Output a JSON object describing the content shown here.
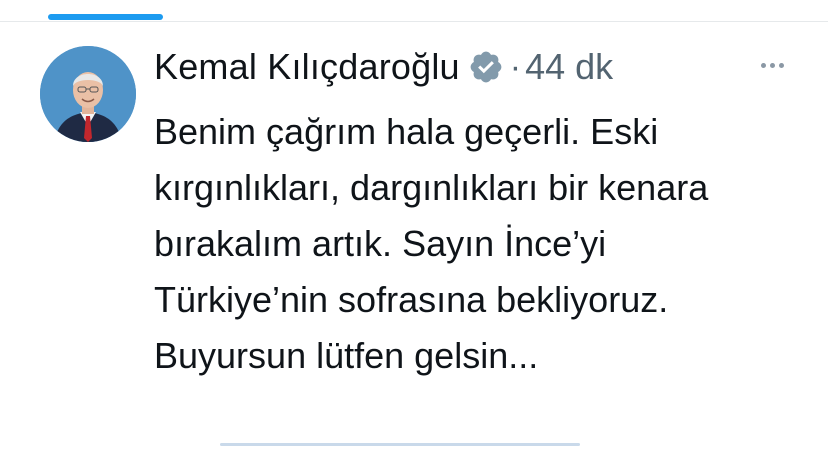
{
  "tweet": {
    "author_name": "Kemal Kılıçdaroğlu",
    "separator": "·",
    "time": "44 dk",
    "text": "Benim çağrım hala geçerli. Eski\nkırgınlıkları, dargınlıkları bir kenara\nbırakalım artık. Sayın İnce’yi\nTürkiye’nin sofrasına bekliyoruz.\nBuyursun lütfen gelsin..."
  },
  "icons": {
    "verified": "verified-badge-icon",
    "more": "more-options-icon"
  },
  "colors": {
    "accent": "#1d9bf0",
    "text_primary": "#0f1419",
    "text_secondary": "#536471",
    "verified_badge": "#829aab",
    "avatar_bg": "#4f93c8"
  }
}
